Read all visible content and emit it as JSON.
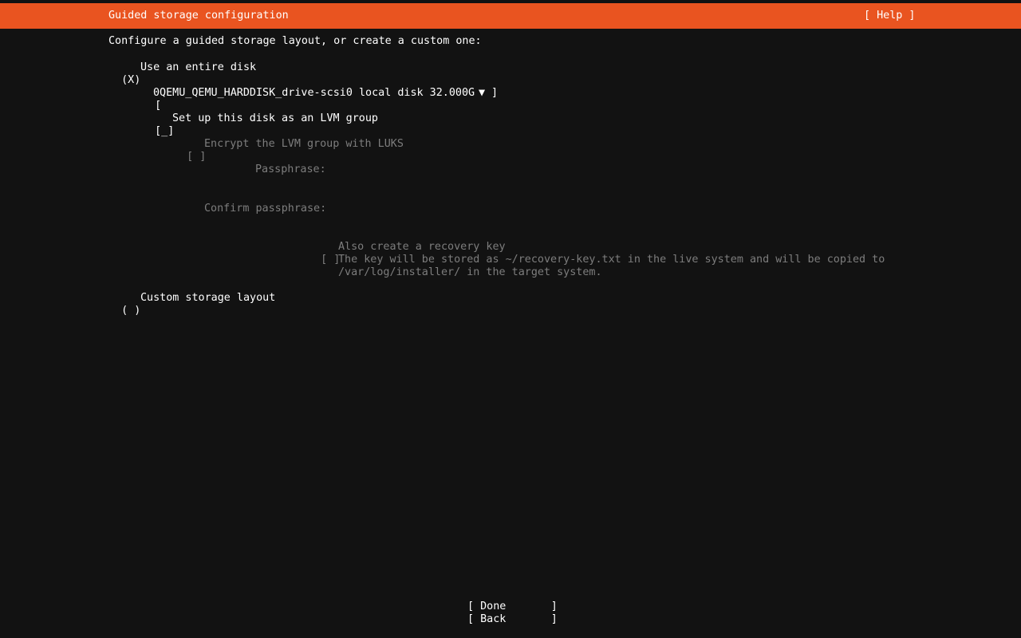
{
  "header": {
    "title": "Guided storage configuration",
    "help": "[ Help ]",
    "color": "#e95420"
  },
  "intro": "Configure a guided storage layout, or create a custom one:",
  "options": {
    "entire_disk": {
      "marker": "(X)",
      "label": "Use an entire disk"
    },
    "disk_select": {
      "open": "[",
      "value": "0QEMU_QEMU_HARDDISK_drive-scsi0 local disk 32.000G",
      "arrow": "▼",
      "close": "]"
    },
    "lvm": {
      "marker": "[_]",
      "label": "Set up this disk as an LVM group"
    },
    "encrypt": {
      "marker": "[ ]",
      "label": "Encrypt the LVM group with LUKS"
    },
    "passphrase": {
      "label": "Passphrase:",
      "value": ""
    },
    "confirm_passphrase": {
      "label": "Confirm passphrase:",
      "value": ""
    },
    "recovery_key": {
      "marker": "[ ]",
      "label": "Also create a recovery key",
      "description_line1": "The key will be stored as ~/recovery-key.txt in the live system and will be copied to",
      "description_line2": "/var/log/installer/ in the target system."
    },
    "custom": {
      "marker": "( )",
      "label": "Custom storage layout"
    }
  },
  "buttons": {
    "done": "[ Done       ]",
    "back": "[ Back       ]"
  }
}
